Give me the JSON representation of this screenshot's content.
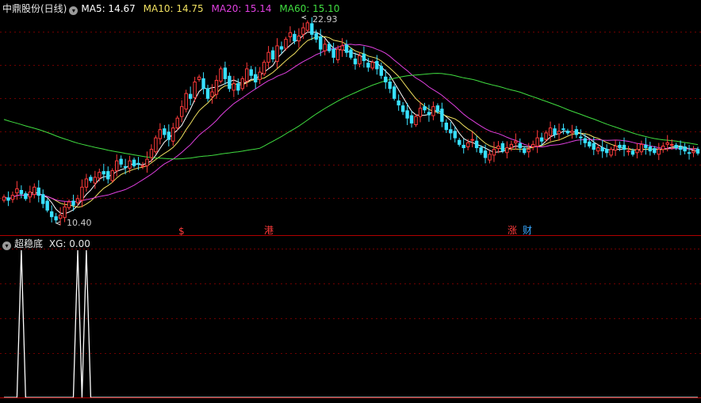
{
  "price_panel": {
    "title": "中鼎股份(日线)",
    "ma5_label": "MA5: 14.67",
    "ma10_label": "MA10: 14.75",
    "ma20_label": "MA20: 15.14",
    "ma60_label": "MA60: 15.10",
    "max_label": "22.93",
    "min_label": "10.40",
    "markers": [
      "$",
      "港",
      "涨",
      "财"
    ]
  },
  "indicator_panel": {
    "title": "超稳底",
    "xg_label": "XG: 0.00"
  },
  "colors": {
    "up": "#ff3b3b",
    "down": "#38e0ff",
    "ma5": "#ffffff",
    "ma10": "#f0e060",
    "ma20": "#e040e0",
    "ma60": "#40dd40",
    "panel_line": "#b00000",
    "grid": "#6e0000",
    "indicator": "#ffffff"
  },
  "chart_data": [
    {
      "type": "candlestick",
      "title": "中鼎股份(日线)",
      "ylim": [
        10.4,
        22.93
      ],
      "series": [
        {
          "name": "MA5",
          "last": 14.67
        },
        {
          "name": "MA10",
          "last": 14.75
        },
        {
          "name": "MA20",
          "last": 15.14
        },
        {
          "name": "MA60",
          "last": 15.1
        }
      ],
      "close": [
        12.0,
        11.8,
        12.1,
        12.5,
        12.2,
        11.9,
        12.3,
        12.6,
        12.1,
        11.6,
        11.2,
        10.8,
        10.6,
        10.9,
        11.4,
        11.7,
        11.5,
        11.9,
        12.6,
        13.1,
        13.0,
        13.2,
        13.5,
        13.4,
        13.1,
        13.6,
        14.2,
        14.0,
        13.8,
        14.2,
        13.9,
        14.0,
        13.9,
        14.3,
        14.9,
        15.6,
        16.1,
        15.8,
        15.5,
        16.2,
        16.8,
        17.5,
        18.3,
        18.0,
        19.0,
        19.3,
        18.6,
        18.0,
        18.4,
        19.1,
        19.8,
        19.2,
        18.6,
        18.9,
        18.5,
        19.2,
        19.8,
        19.4,
        19.0,
        19.6,
        20.2,
        20.8,
        20.4,
        21.2,
        21.0,
        21.6,
        22.0,
        21.5,
        21.8,
        22.3,
        22.6,
        21.9,
        21.6,
        21.0,
        21.3,
        20.9,
        20.5,
        21.0,
        21.2,
        20.8,
        20.5,
        20.1,
        20.6,
        20.3,
        19.9,
        20.2,
        19.8,
        19.4,
        19.0,
        18.6,
        18.0,
        17.6,
        17.2,
        16.8,
        16.5,
        16.9,
        17.4,
        17.3,
        17.0,
        17.5,
        17.2,
        16.6,
        16.1,
        15.9,
        15.6,
        15.2,
        15.0,
        15.3,
        15.5,
        15.0,
        14.7,
        14.4,
        14.6,
        14.9,
        15.1,
        14.8,
        15.0,
        15.2,
        15.4,
        15.0,
        14.7,
        14.9,
        15.2,
        15.6,
        15.4,
        15.9,
        16.2,
        15.8,
        16.0,
        16.1,
        15.9,
        16.0,
        15.8,
        15.6,
        15.3,
        15.1,
        14.9,
        15.0,
        14.8,
        14.7,
        14.9,
        15.1,
        15.0,
        14.9,
        14.8,
        14.6,
        14.9,
        15.2,
        15.0,
        14.8,
        14.7,
        14.9,
        15.1,
        15.3,
        15.2,
        15.0,
        14.9,
        14.8,
        14.7,
        14.8,
        14.67
      ]
    },
    {
      "type": "line",
      "title": "超稳底",
      "series": [
        {
          "name": "XG",
          "last": 0.0
        }
      ],
      "signal_bars": [
        4,
        17,
        19
      ]
    }
  ]
}
